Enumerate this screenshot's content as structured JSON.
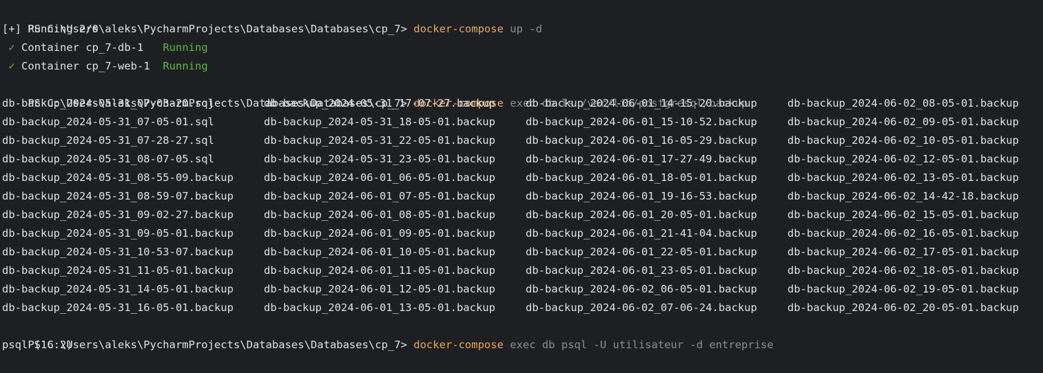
{
  "colors": {
    "background": "#1e1f22",
    "text": "#dfe1e5",
    "command": "#e8a75c",
    "args": "#8c8f94",
    "success": "#5fb845"
  },
  "prompt": "PS C:\\Users\\aleks\\PycharmProjects\\Databases\\Databases\\cp_7> ",
  "commands": [
    {
      "cmd": "docker-compose",
      "args": " up -d"
    },
    {
      "cmd": "docker-compose",
      "args": " exec db ls /var/lib/postgresql/backup"
    },
    {
      "cmd": "docker-compose",
      "args": " exec db psql -U utilisateur -d entreprise"
    }
  ],
  "up_output": {
    "status": "[+] Running 2/0",
    "containers": [
      {
        "check": "✓",
        "label": "Container cp_7-db-1   ",
        "state": "Running"
      },
      {
        "check": "✓",
        "label": "Container cp_7-web-1  ",
        "state": "Running"
      }
    ]
  },
  "ls_output": [
    [
      "db-backup_2024-05-31_07-03-20.sql",
      "db-backup_2024-05-31_17-07-27.backup",
      "db-backup_2024-06-01_14-15-20.backup",
      "db-backup_2024-06-02_08-05-01.backup"
    ],
    [
      "db-backup_2024-05-31_07-05-01.sql",
      "db-backup_2024-05-31_18-05-01.backup",
      "db-backup_2024-06-01_15-10-52.backup",
      "db-backup_2024-06-02_09-05-01.backup"
    ],
    [
      "db-backup_2024-05-31_07-28-27.sql",
      "db-backup_2024-05-31_22-05-01.backup",
      "db-backup_2024-06-01_16-05-29.backup",
      "db-backup_2024-06-02_10-05-01.backup"
    ],
    [
      "db-backup_2024-05-31_08-07-05.sql",
      "db-backup_2024-05-31_23-05-01.backup",
      "db-backup_2024-06-01_17-27-49.backup",
      "db-backup_2024-06-02_12-05-01.backup"
    ],
    [
      "db-backup_2024-05-31_08-55-09.backup",
      "db-backup_2024-06-01_06-05-01.backup",
      "db-backup_2024-06-01_18-05-01.backup",
      "db-backup_2024-06-02_13-05-01.backup"
    ],
    [
      "db-backup_2024-05-31_08-59-07.backup",
      "db-backup_2024-06-01_07-05-01.backup",
      "db-backup_2024-06-01_19-16-53.backup",
      "db-backup_2024-06-02_14-42-18.backup"
    ],
    [
      "db-backup_2024-05-31_09-02-27.backup",
      "db-backup_2024-06-01_08-05-01.backup",
      "db-backup_2024-06-01_20-05-01.backup",
      "db-backup_2024-06-02_15-05-01.backup"
    ],
    [
      "db-backup_2024-05-31_09-05-01.backup",
      "db-backup_2024-06-01_09-05-01.backup",
      "db-backup_2024-06-01_21-41-04.backup",
      "db-backup_2024-06-02_16-05-01.backup"
    ],
    [
      "db-backup_2024-05-31_10-53-07.backup",
      "db-backup_2024-06-01_10-05-01.backup",
      "db-backup_2024-06-01_22-05-01.backup",
      "db-backup_2024-06-02_17-05-01.backup"
    ],
    [
      "db-backup_2024-05-31_11-05-01.backup",
      "db-backup_2024-06-01_11-05-01.backup",
      "db-backup_2024-06-01_23-05-01.backup",
      "db-backup_2024-06-02_18-05-01.backup"
    ],
    [
      "db-backup_2024-05-31_14-05-01.backup",
      "db-backup_2024-06-01_12-05-01.backup",
      "db-backup_2024-06-02_06-05-01.backup",
      "db-backup_2024-06-02_19-05-01.backup"
    ],
    [
      "db-backup_2024-05-31_16-05-01.backup",
      "db-backup_2024-06-01_13-05-01.backup",
      "db-backup_2024-06-02_07-06-24.backup",
      "db-backup_2024-06-02_20-05-01.backup"
    ]
  ],
  "psql_output": "psql (16.2)"
}
